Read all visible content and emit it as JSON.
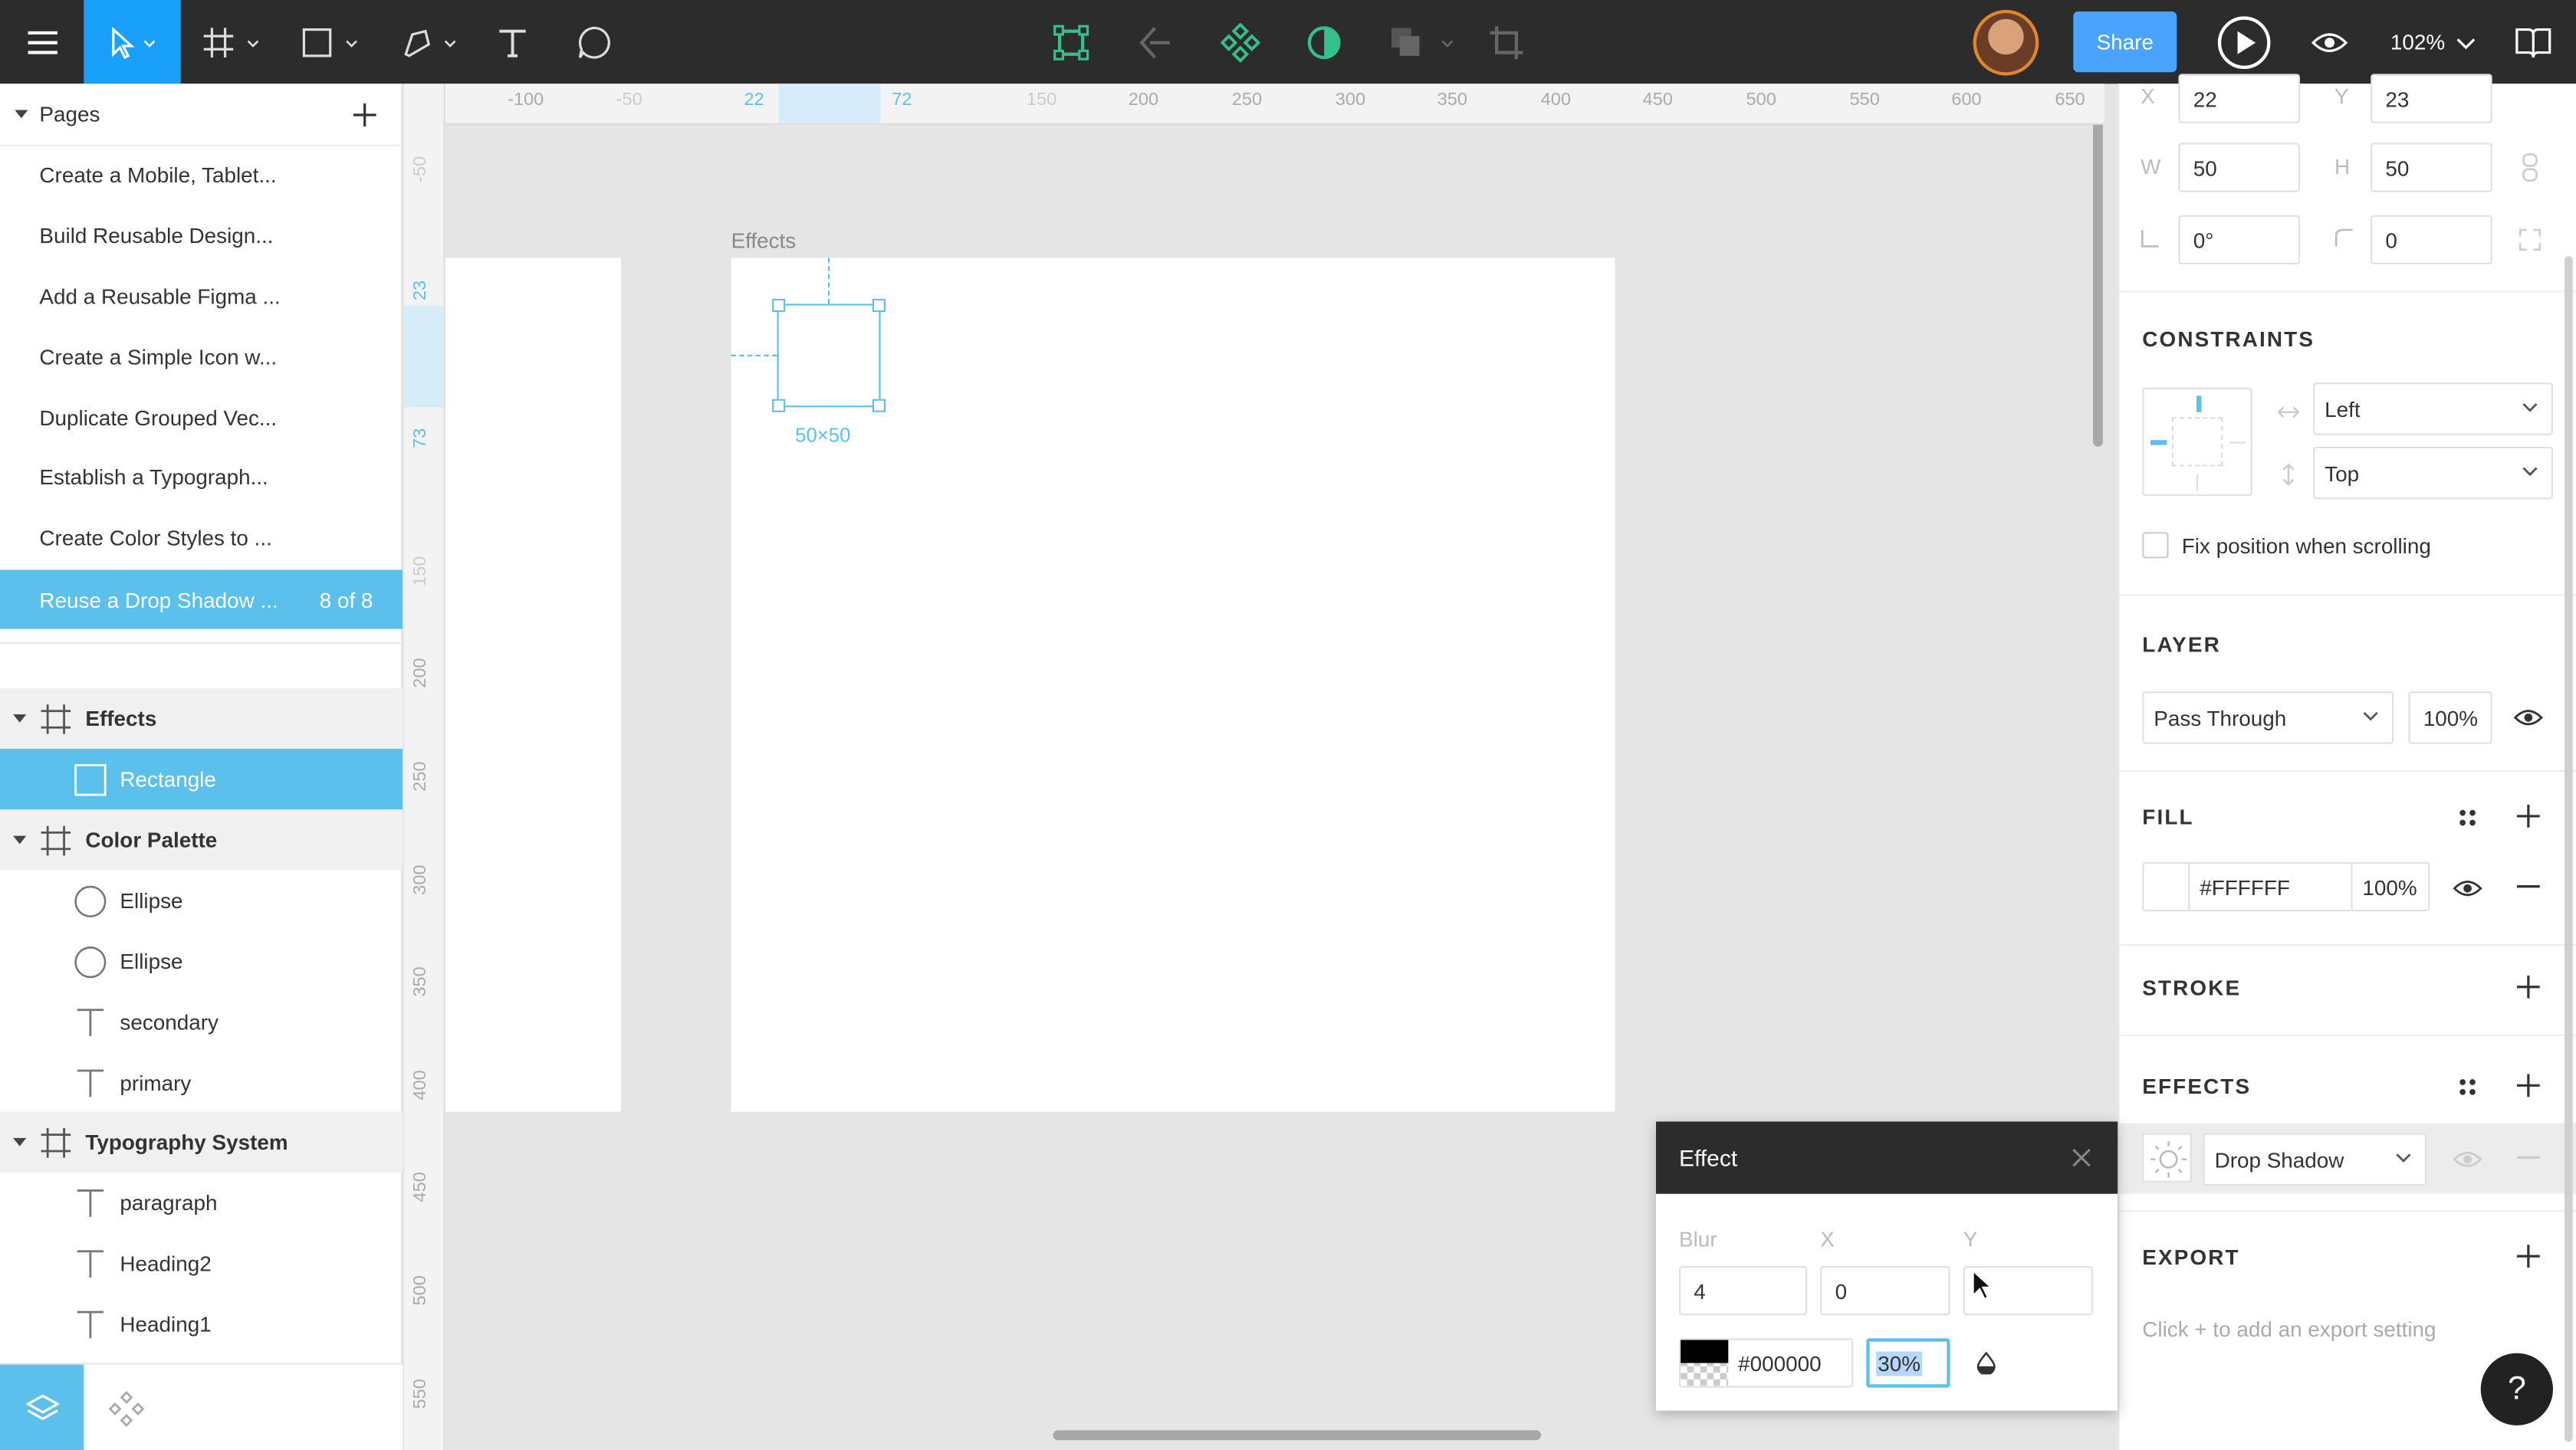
{
  "toolbar": {
    "tools": [
      "menu-icon",
      "move-tool",
      "frame-tool",
      "shape-tool",
      "pen-tool",
      "text-tool",
      "comment-tool"
    ],
    "center_tools": [
      "edit-object-icon",
      "boolean-icon",
      "component-icon",
      "mask-icon",
      "group-icon",
      "crop-icon"
    ],
    "share_label": "Share",
    "zoom": "102%",
    "accent": "#18a0fb"
  },
  "pages": {
    "title": "Pages",
    "items": [
      {
        "label": "Create a Mobile, Tablet..."
      },
      {
        "label": "Build Reusable Design..."
      },
      {
        "label": "Add a Reusable Figma ..."
      },
      {
        "label": "Create a Simple Icon w..."
      },
      {
        "label": "Duplicate Grouped Vec..."
      },
      {
        "label": "Establish a Typograph..."
      },
      {
        "label": "Create Color Styles to ..."
      },
      {
        "label": "Reuse a Drop Shadow ...",
        "count": "8 of 8"
      }
    ]
  },
  "layers": {
    "effects_group": "Effects",
    "rectangle": "Rectangle",
    "color_palette": "Color Palette",
    "ellipse1": "Ellipse",
    "ellipse2": "Ellipse",
    "secondary": "secondary",
    "primary": "primary",
    "typography": "Typography System",
    "paragraph": "paragraph",
    "heading2": "Heading2",
    "heading1": "Heading1"
  },
  "ruler": {
    "top": [
      "-100",
      "-50",
      "22",
      "72",
      "150",
      "200",
      "250",
      "300",
      "350",
      "400",
      "450",
      "500",
      "550",
      "600",
      "650"
    ],
    "left": [
      "-50",
      "23",
      "73",
      "150",
      "200",
      "250",
      "300",
      "350",
      "400",
      "450",
      "500",
      "550"
    ]
  },
  "canvas": {
    "frame_label": "Effects",
    "size_label": "50×50"
  },
  "design": {
    "x_label": "X",
    "x": "22",
    "y_label": "Y",
    "y": "23",
    "w_label": "W",
    "w": "50",
    "h_label": "H",
    "h": "50",
    "rotation": "0°",
    "radius": "0",
    "constraints_title": "CONSTRAINTS",
    "constraint_h": "Left",
    "constraint_v": "Top",
    "fix_position": "Fix position when scrolling",
    "layer_title": "LAYER",
    "blend": "Pass Through",
    "layer_opacity": "100%",
    "fill_title": "FILL",
    "fill_hex": "#FFFFFF",
    "fill_opacity": "100%",
    "stroke_title": "STROKE",
    "effects_title": "EFFECTS",
    "effect_type": "Drop Shadow",
    "export_title": "EXPORT",
    "export_hint": "Click + to add an export setting"
  },
  "effect_popup": {
    "title": "Effect",
    "blur_label": "Blur",
    "blur": "4",
    "x_label": "X",
    "x": "0",
    "y_label": "Y",
    "y": "",
    "color_hex": "#000000",
    "opacity": "30%"
  },
  "help": "?"
}
